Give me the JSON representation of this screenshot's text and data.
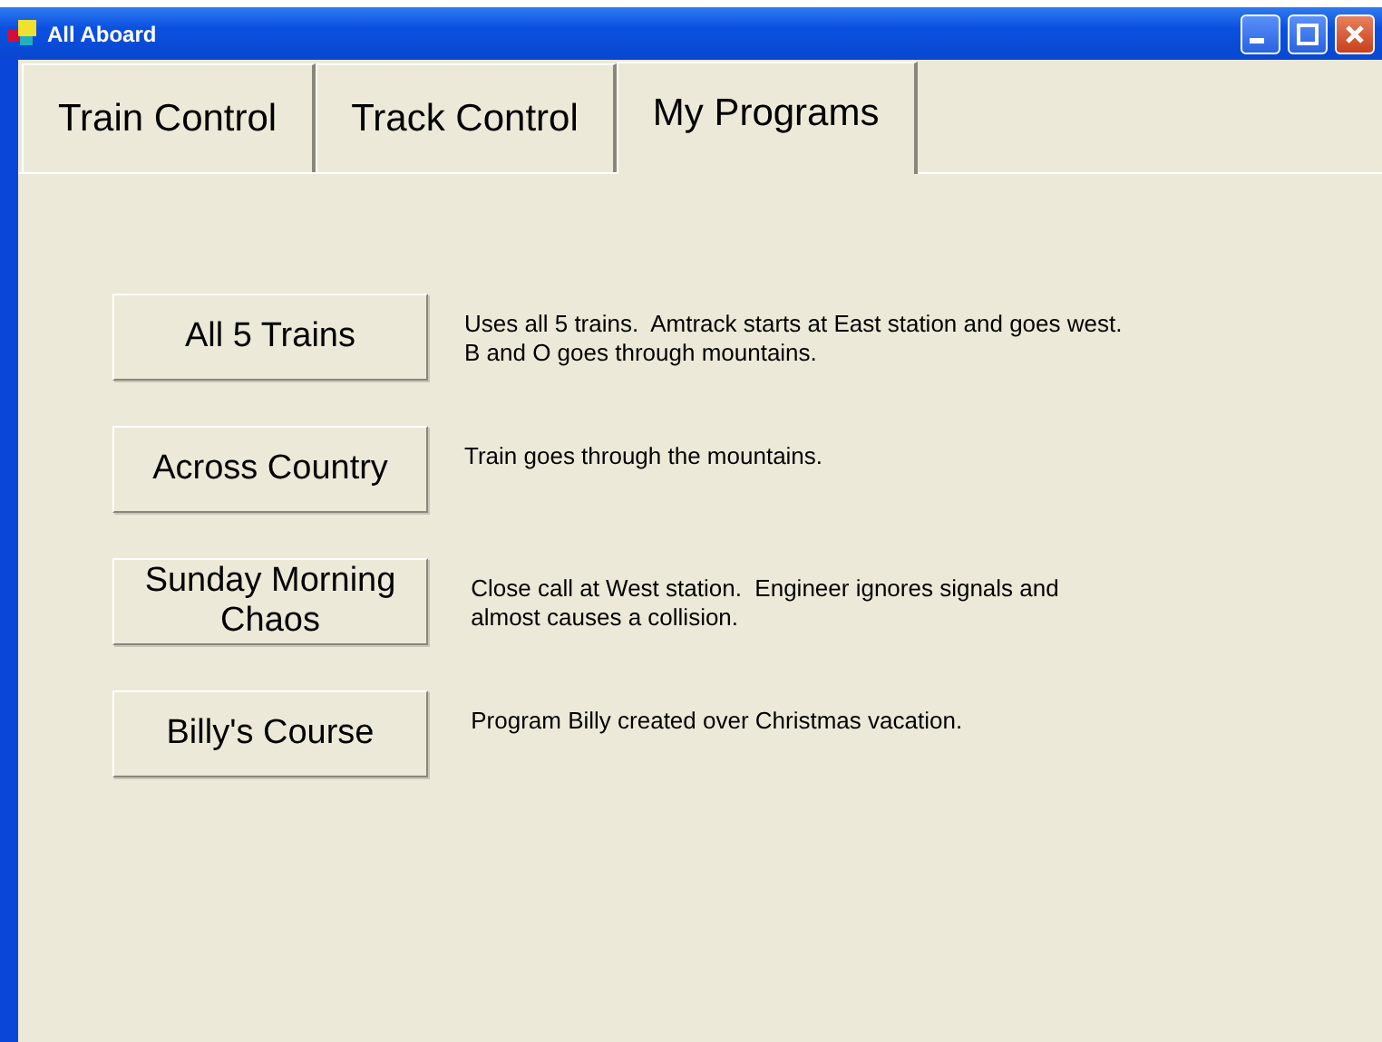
{
  "window": {
    "title": "All Aboard"
  },
  "tabs": [
    {
      "label": "Train Control",
      "selected": false
    },
    {
      "label": "Track Control",
      "selected": false
    },
    {
      "label": "My Programs",
      "selected": true
    }
  ],
  "programs": [
    {
      "button": "All 5 Trains",
      "description": "Uses all 5 trains.  Amtrack starts at East station and goes west.\nB and O goes through mountains."
    },
    {
      "button": "Across Country",
      "description": "Train goes through the mountains."
    },
    {
      "button": "Sunday Morning Chaos",
      "description": " Close call at West station.  Engineer ignores signals and\n almost causes a collision."
    },
    {
      "button": "Billy's Course",
      "description": " Program Billy created over Christmas vacation."
    }
  ]
}
